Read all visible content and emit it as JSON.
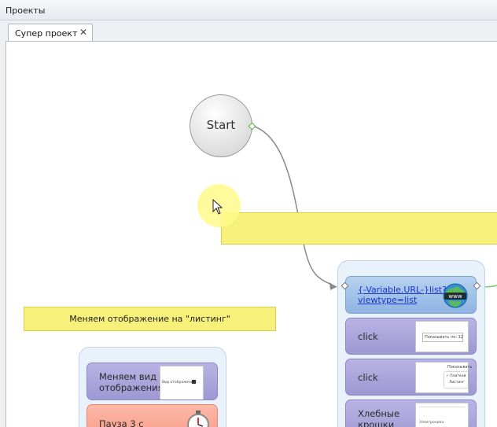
{
  "panel": {
    "title": "Проекты"
  },
  "tabs": [
    {
      "label": "Супер проект",
      "close": "✕"
    }
  ],
  "canvas": {
    "start_node": {
      "label": "Start"
    },
    "notes": [
      {
        "text": ""
      },
      {
        "text": "Меняем отображение на \"листинг\""
      }
    ],
    "right_group": {
      "blocks": [
        {
          "kind": "url",
          "link": "{-Variable.URL-}list?viewtype=list",
          "link_line1": "{-Variable.URL-}list?",
          "link_line2": "viewtype=list",
          "icon": "www-globe-icon"
        },
        {
          "kind": "action",
          "label": "click",
          "thumb_text": "Показывать по: 12"
        },
        {
          "kind": "action",
          "label": "click",
          "thumb_text": "Показывать",
          "thumb_items": [
            "✓ Плиткой",
            "Листинг"
          ]
        },
        {
          "kind": "action",
          "label": "Хлебные крошки",
          "label_line1": "Хлебные",
          "label_line2": "крошки",
          "thumb_text": "Электроника"
        }
      ]
    },
    "left_group": {
      "blocks": [
        {
          "kind": "action",
          "label": "Меняем вид отображения",
          "label_line1": "Меняем вид",
          "label_line2": "отображения",
          "thumb_text": "Вид отображения:"
        },
        {
          "kind": "pause",
          "label": "Пауза 3 с",
          "icon": "stopwatch-icon"
        }
      ]
    }
  },
  "colors": {
    "note": "#f7f07a",
    "group_bg": "#e9f1fb",
    "action_block": "#aea8dc",
    "url_block": "#a3c3ea",
    "pause_block": "#f7a792",
    "wire": "#8a8a8a",
    "wire_green": "#7ccf6a"
  }
}
